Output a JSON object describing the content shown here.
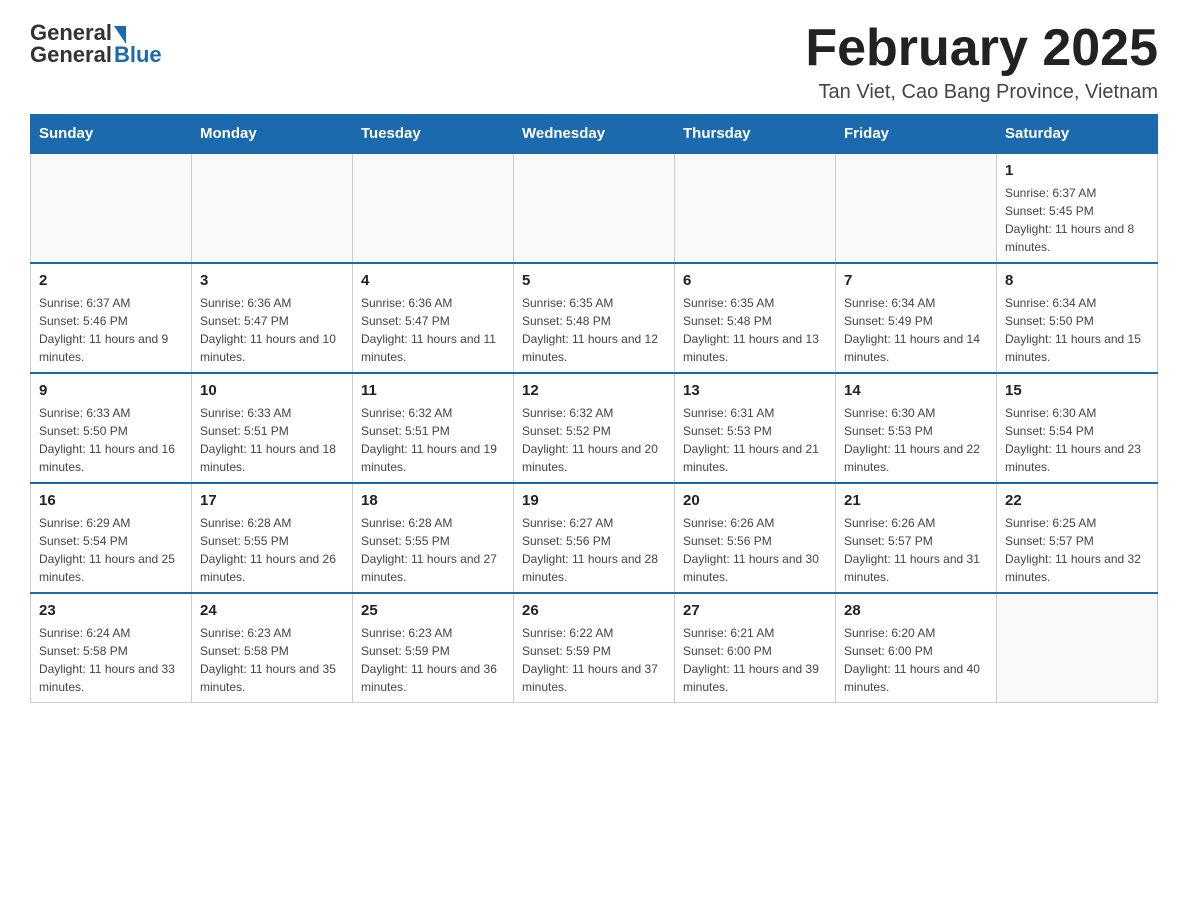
{
  "logo": {
    "general": "General",
    "blue": "Blue"
  },
  "title": "February 2025",
  "subtitle": "Tan Viet, Cao Bang Province, Vietnam",
  "days_of_week": [
    "Sunday",
    "Monday",
    "Tuesday",
    "Wednesday",
    "Thursday",
    "Friday",
    "Saturday"
  ],
  "weeks": [
    [
      {
        "day": "",
        "sunrise": "",
        "sunset": "",
        "daylight": "",
        "empty": true
      },
      {
        "day": "",
        "sunrise": "",
        "sunset": "",
        "daylight": "",
        "empty": true
      },
      {
        "day": "",
        "sunrise": "",
        "sunset": "",
        "daylight": "",
        "empty": true
      },
      {
        "day": "",
        "sunrise": "",
        "sunset": "",
        "daylight": "",
        "empty": true
      },
      {
        "day": "",
        "sunrise": "",
        "sunset": "",
        "daylight": "",
        "empty": true
      },
      {
        "day": "",
        "sunrise": "",
        "sunset": "",
        "daylight": "",
        "empty": true
      },
      {
        "day": "1",
        "sunrise": "Sunrise: 6:37 AM",
        "sunset": "Sunset: 5:45 PM",
        "daylight": "Daylight: 11 hours and 8 minutes.",
        "empty": false
      }
    ],
    [
      {
        "day": "2",
        "sunrise": "Sunrise: 6:37 AM",
        "sunset": "Sunset: 5:46 PM",
        "daylight": "Daylight: 11 hours and 9 minutes.",
        "empty": false
      },
      {
        "day": "3",
        "sunrise": "Sunrise: 6:36 AM",
        "sunset": "Sunset: 5:47 PM",
        "daylight": "Daylight: 11 hours and 10 minutes.",
        "empty": false
      },
      {
        "day": "4",
        "sunrise": "Sunrise: 6:36 AM",
        "sunset": "Sunset: 5:47 PM",
        "daylight": "Daylight: 11 hours and 11 minutes.",
        "empty": false
      },
      {
        "day": "5",
        "sunrise": "Sunrise: 6:35 AM",
        "sunset": "Sunset: 5:48 PM",
        "daylight": "Daylight: 11 hours and 12 minutes.",
        "empty": false
      },
      {
        "day": "6",
        "sunrise": "Sunrise: 6:35 AM",
        "sunset": "Sunset: 5:48 PM",
        "daylight": "Daylight: 11 hours and 13 minutes.",
        "empty": false
      },
      {
        "day": "7",
        "sunrise": "Sunrise: 6:34 AM",
        "sunset": "Sunset: 5:49 PM",
        "daylight": "Daylight: 11 hours and 14 minutes.",
        "empty": false
      },
      {
        "day": "8",
        "sunrise": "Sunrise: 6:34 AM",
        "sunset": "Sunset: 5:50 PM",
        "daylight": "Daylight: 11 hours and 15 minutes.",
        "empty": false
      }
    ],
    [
      {
        "day": "9",
        "sunrise": "Sunrise: 6:33 AM",
        "sunset": "Sunset: 5:50 PM",
        "daylight": "Daylight: 11 hours and 16 minutes.",
        "empty": false
      },
      {
        "day": "10",
        "sunrise": "Sunrise: 6:33 AM",
        "sunset": "Sunset: 5:51 PM",
        "daylight": "Daylight: 11 hours and 18 minutes.",
        "empty": false
      },
      {
        "day": "11",
        "sunrise": "Sunrise: 6:32 AM",
        "sunset": "Sunset: 5:51 PM",
        "daylight": "Daylight: 11 hours and 19 minutes.",
        "empty": false
      },
      {
        "day": "12",
        "sunrise": "Sunrise: 6:32 AM",
        "sunset": "Sunset: 5:52 PM",
        "daylight": "Daylight: 11 hours and 20 minutes.",
        "empty": false
      },
      {
        "day": "13",
        "sunrise": "Sunrise: 6:31 AM",
        "sunset": "Sunset: 5:53 PM",
        "daylight": "Daylight: 11 hours and 21 minutes.",
        "empty": false
      },
      {
        "day": "14",
        "sunrise": "Sunrise: 6:30 AM",
        "sunset": "Sunset: 5:53 PM",
        "daylight": "Daylight: 11 hours and 22 minutes.",
        "empty": false
      },
      {
        "day": "15",
        "sunrise": "Sunrise: 6:30 AM",
        "sunset": "Sunset: 5:54 PM",
        "daylight": "Daylight: 11 hours and 23 minutes.",
        "empty": false
      }
    ],
    [
      {
        "day": "16",
        "sunrise": "Sunrise: 6:29 AM",
        "sunset": "Sunset: 5:54 PM",
        "daylight": "Daylight: 11 hours and 25 minutes.",
        "empty": false
      },
      {
        "day": "17",
        "sunrise": "Sunrise: 6:28 AM",
        "sunset": "Sunset: 5:55 PM",
        "daylight": "Daylight: 11 hours and 26 minutes.",
        "empty": false
      },
      {
        "day": "18",
        "sunrise": "Sunrise: 6:28 AM",
        "sunset": "Sunset: 5:55 PM",
        "daylight": "Daylight: 11 hours and 27 minutes.",
        "empty": false
      },
      {
        "day": "19",
        "sunrise": "Sunrise: 6:27 AM",
        "sunset": "Sunset: 5:56 PM",
        "daylight": "Daylight: 11 hours and 28 minutes.",
        "empty": false
      },
      {
        "day": "20",
        "sunrise": "Sunrise: 6:26 AM",
        "sunset": "Sunset: 5:56 PM",
        "daylight": "Daylight: 11 hours and 30 minutes.",
        "empty": false
      },
      {
        "day": "21",
        "sunrise": "Sunrise: 6:26 AM",
        "sunset": "Sunset: 5:57 PM",
        "daylight": "Daylight: 11 hours and 31 minutes.",
        "empty": false
      },
      {
        "day": "22",
        "sunrise": "Sunrise: 6:25 AM",
        "sunset": "Sunset: 5:57 PM",
        "daylight": "Daylight: 11 hours and 32 minutes.",
        "empty": false
      }
    ],
    [
      {
        "day": "23",
        "sunrise": "Sunrise: 6:24 AM",
        "sunset": "Sunset: 5:58 PM",
        "daylight": "Daylight: 11 hours and 33 minutes.",
        "empty": false
      },
      {
        "day": "24",
        "sunrise": "Sunrise: 6:23 AM",
        "sunset": "Sunset: 5:58 PM",
        "daylight": "Daylight: 11 hours and 35 minutes.",
        "empty": false
      },
      {
        "day": "25",
        "sunrise": "Sunrise: 6:23 AM",
        "sunset": "Sunset: 5:59 PM",
        "daylight": "Daylight: 11 hours and 36 minutes.",
        "empty": false
      },
      {
        "day": "26",
        "sunrise": "Sunrise: 6:22 AM",
        "sunset": "Sunset: 5:59 PM",
        "daylight": "Daylight: 11 hours and 37 minutes.",
        "empty": false
      },
      {
        "day": "27",
        "sunrise": "Sunrise: 6:21 AM",
        "sunset": "Sunset: 6:00 PM",
        "daylight": "Daylight: 11 hours and 39 minutes.",
        "empty": false
      },
      {
        "day": "28",
        "sunrise": "Sunrise: 6:20 AM",
        "sunset": "Sunset: 6:00 PM",
        "daylight": "Daylight: 11 hours and 40 minutes.",
        "empty": false
      },
      {
        "day": "",
        "sunrise": "",
        "sunset": "",
        "daylight": "",
        "empty": true
      }
    ]
  ]
}
